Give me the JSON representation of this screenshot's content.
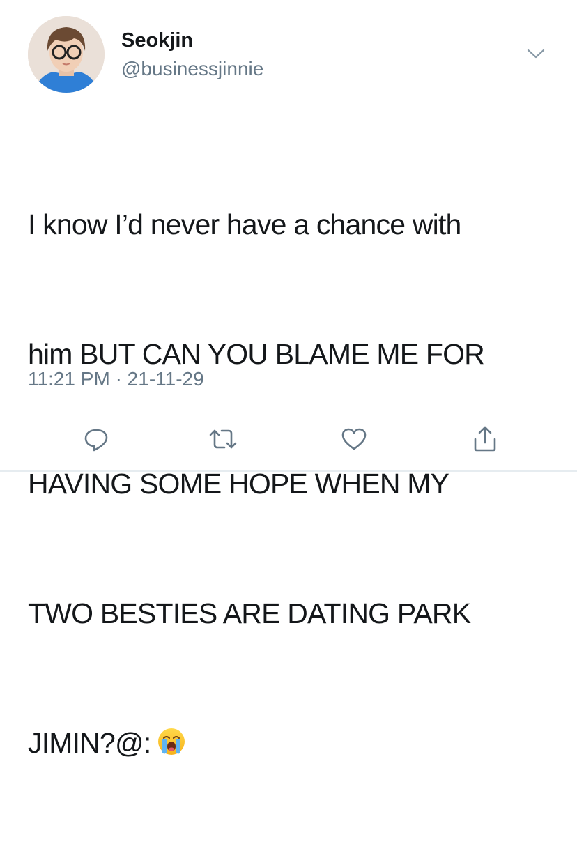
{
  "author": {
    "display_name": "Seokjin",
    "handle": "@businessjinnie",
    "avatar_icon": "profile-photo"
  },
  "tweet": {
    "lines": [
      "I know I’d never have a chance with",
      "him BUT CAN YOU BLAME ME FOR",
      "HAVING SOME HOPE WHEN MY",
      "TWO BESTIES ARE DATING PARK",
      "JIMIN?@:"
    ],
    "emoji": "loudly-crying-face",
    "time": "11:21 PM",
    "separator": "·",
    "date": "21-11-29"
  },
  "actions": [
    {
      "name": "reply",
      "icon": "reply-icon"
    },
    {
      "name": "retweet",
      "icon": "retweet-icon"
    },
    {
      "name": "like",
      "icon": "heart-icon"
    },
    {
      "name": "share",
      "icon": "share-icon"
    }
  ],
  "colors": {
    "text": "#14171a",
    "secondary": "#657786",
    "divider": "#ccd6dd",
    "icon": "#657786"
  }
}
